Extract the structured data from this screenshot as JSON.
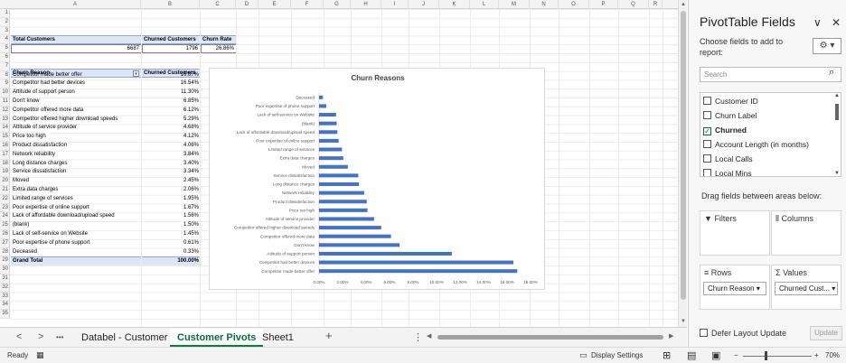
{
  "columns": [
    "A",
    "B",
    "C",
    "D",
    "E",
    "F",
    "G",
    "H",
    "I",
    "J",
    "K",
    "L",
    "M",
    "N",
    "O",
    "P",
    "Q",
    "R"
  ],
  "rows": [
    "1",
    "2",
    "3",
    "4",
    "5",
    "6",
    "7",
    "8",
    "9",
    "10",
    "11",
    "12",
    "13",
    "14",
    "15",
    "16",
    "17",
    "18",
    "19",
    "20",
    "21",
    "22",
    "23",
    "24",
    "25",
    "26",
    "27",
    "28",
    "29",
    "30",
    "31",
    "32",
    "33",
    "34",
    "35"
  ],
  "summary": {
    "h_total": "Total Customers",
    "h_churned": "Churned Customers",
    "h_rate": "Churn Rate",
    "v_total": "6687",
    "v_churned": "1796",
    "v_rate": "26.86%"
  },
  "pivot_table": {
    "h_reason": "Churn Reason",
    "h_churned": "Churned Customers",
    "rows": [
      {
        "reason": "Competitor made better offer",
        "value": "16.87%"
      },
      {
        "reason": "Competitor had better devices",
        "value": "16.54%"
      },
      {
        "reason": "Attitude of support person",
        "value": "11.30%"
      },
      {
        "reason": "Don't know",
        "value": "6.85%"
      },
      {
        "reason": "Competitor offered more data",
        "value": "6.12%"
      },
      {
        "reason": "Competitor offered higher download speeds",
        "value": "5.29%"
      },
      {
        "reason": "Attitude of service provider",
        "value": "4.68%"
      },
      {
        "reason": "Price too high",
        "value": "4.12%"
      },
      {
        "reason": "Product dissatisfaction",
        "value": "4.06%"
      },
      {
        "reason": "Network reliability",
        "value": "3.84%"
      },
      {
        "reason": "Long distance charges",
        "value": "3.40%"
      },
      {
        "reason": "Service dissatisfaction",
        "value": "3.34%"
      },
      {
        "reason": "Moved",
        "value": "2.45%"
      },
      {
        "reason": "Extra data charges",
        "value": "2.06%"
      },
      {
        "reason": "Limited range of services",
        "value": "1.95%"
      },
      {
        "reason": "Poor expertise of online support",
        "value": "1.67%"
      },
      {
        "reason": "Lack of affordable download/upload speed",
        "value": "1.56%"
      },
      {
        "reason": "(blank)",
        "value": "1.50%"
      },
      {
        "reason": "Lack of self-service on Website",
        "value": "1.45%"
      },
      {
        "reason": "Poor expertise of phone support",
        "value": "0.61%"
      },
      {
        "reason": "Deceased",
        "value": "0.33%"
      }
    ],
    "grand_label": "Grand Total",
    "grand_value": "100.00%"
  },
  "chart_data": {
    "type": "bar",
    "orientation": "horizontal",
    "title": "Churn Reasons",
    "categories": [
      "Deceased",
      "Poor expertise of phone support",
      "Lack of self-service on Website",
      "(blank)",
      "Lack of affordable download/upload speed",
      "Poor expertise of online support",
      "Limited range of services",
      "Extra data charges",
      "Moved",
      "Service dissatisfaction",
      "Long distance charges",
      "Network reliability",
      "Product dissatisfaction",
      "Price too high",
      "Attitude of service provider",
      "Competitor offered higher download speeds",
      "Competitor offered more data",
      "Don't know",
      "Attitude of support person",
      "Competitor had better devices",
      "Competitor made better offer"
    ],
    "values": [
      0.33,
      0.61,
      1.45,
      1.5,
      1.56,
      1.67,
      1.95,
      2.06,
      2.45,
      3.34,
      3.4,
      3.84,
      4.06,
      4.12,
      4.68,
      5.29,
      6.12,
      6.85,
      11.3,
      16.54,
      16.87
    ],
    "xlim": [
      0,
      18
    ],
    "xticks": [
      "0.00%",
      "2.00%",
      "4.00%",
      "6.00%",
      "8.00%",
      "10.00%",
      "12.00%",
      "14.00%",
      "16.00%",
      "18.00%"
    ],
    "bar_color": "#4472c4",
    "grid": false,
    "legend": "none"
  },
  "sheet_tabs": [
    "Databel - Customer",
    "Customer Pivots",
    "Sheet1"
  ],
  "active_sheet": "Customer Pivots",
  "tab_nav": {
    "prev": "<",
    "next": ">",
    "more": "•••",
    "add": "+",
    "menu": "⋮"
  },
  "status": {
    "ready": "Ready",
    "display_settings": "Display Settings",
    "zoom": "70%",
    "zoom_minus": "−",
    "zoom_plus": "+"
  },
  "pivot_pane": {
    "title": "PivotTable Fields",
    "choose": "Choose fields to add to report:",
    "search_placeholder": "Search",
    "fields": [
      {
        "label": "Customer ID",
        "checked": false
      },
      {
        "label": "Churn Label",
        "checked": false
      },
      {
        "label": "Churned",
        "checked": true
      },
      {
        "label": "Account Length (in months)",
        "checked": false
      },
      {
        "label": "Local Calls",
        "checked": false
      },
      {
        "label": "Local Mins",
        "checked": false
      }
    ],
    "drag_label": "Drag fields between areas below:",
    "areas": {
      "filters": "Filters",
      "columns": "Columns",
      "rows": "Rows",
      "values": "Values",
      "rows_chip": "Churn Reason",
      "values_chip": "Churned Cust..."
    },
    "defer": "Defer Layout Update",
    "update": "Update"
  },
  "icons": {
    "dropdown": "▾",
    "close": "✕",
    "chevron_down": "∨",
    "search": "⌕",
    "gear": "⚙",
    "check": "✓"
  }
}
